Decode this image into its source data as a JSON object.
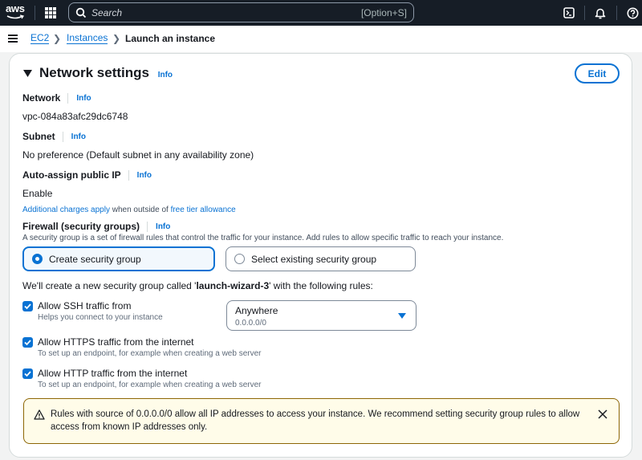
{
  "topbar": {
    "logo": "aws",
    "search_placeholder": "Search",
    "search_shortcut": "[Option+S]",
    "icons": [
      "cloudshell-icon",
      "bell-icon",
      "help-icon"
    ]
  },
  "breadcrumb": {
    "items": [
      {
        "label": "EC2",
        "link": true
      },
      {
        "label": "Instances",
        "link": true
      },
      {
        "label": "Launch an instance",
        "link": false
      }
    ]
  },
  "network_settings": {
    "title": "Network settings",
    "info": "Info",
    "edit_label": "Edit",
    "network": {
      "label": "Network",
      "info": "Info",
      "value": "vpc-084a83afc29dc6748"
    },
    "subnet": {
      "label": "Subnet",
      "info": "Info",
      "value": "No preference (Default subnet in any availability zone)"
    },
    "public_ip": {
      "label": "Auto-assign public IP",
      "info": "Info",
      "value": "Enable",
      "charges_link": "Additional charges apply",
      "charges_middle": " when outside of ",
      "free_tier_link": "free tier allowance"
    },
    "firewall": {
      "label": "Firewall (security groups)",
      "info": "Info",
      "description": "A security group is a set of firewall rules that control the traffic for your instance. Add rules to allow specific traffic to reach your instance.",
      "options": [
        {
          "label": "Create security group",
          "selected": true
        },
        {
          "label": "Select existing security group",
          "selected": false
        }
      ],
      "intro_prefix": "We'll create a new security group called '",
      "group_name": "launch-wizard-3",
      "intro_suffix": "' with the following rules:"
    },
    "rules": [
      {
        "label": "Allow SSH traffic from",
        "description": "Helps you connect to your instance",
        "checked": true
      },
      {
        "label": "Allow HTTPS traffic from the internet",
        "description": "To set up an endpoint, for example when creating a web server",
        "checked": true
      },
      {
        "label": "Allow HTTP traffic from the internet",
        "description": "To set up an endpoint, for example when creating a web server",
        "checked": true
      }
    ],
    "ssh_source": {
      "value": "Anywhere",
      "sub": "0.0.0.0/0"
    },
    "alert": {
      "message": "Rules with source of 0.0.0.0/0 allow all IP addresses to access your instance. We recommend setting security group rules to allow access from known IP addresses only."
    }
  },
  "colors": {
    "accent": "#0972d3",
    "topbar": "#161d26",
    "warning_bg": "#fffce9",
    "warning_border": "#8d6605"
  }
}
